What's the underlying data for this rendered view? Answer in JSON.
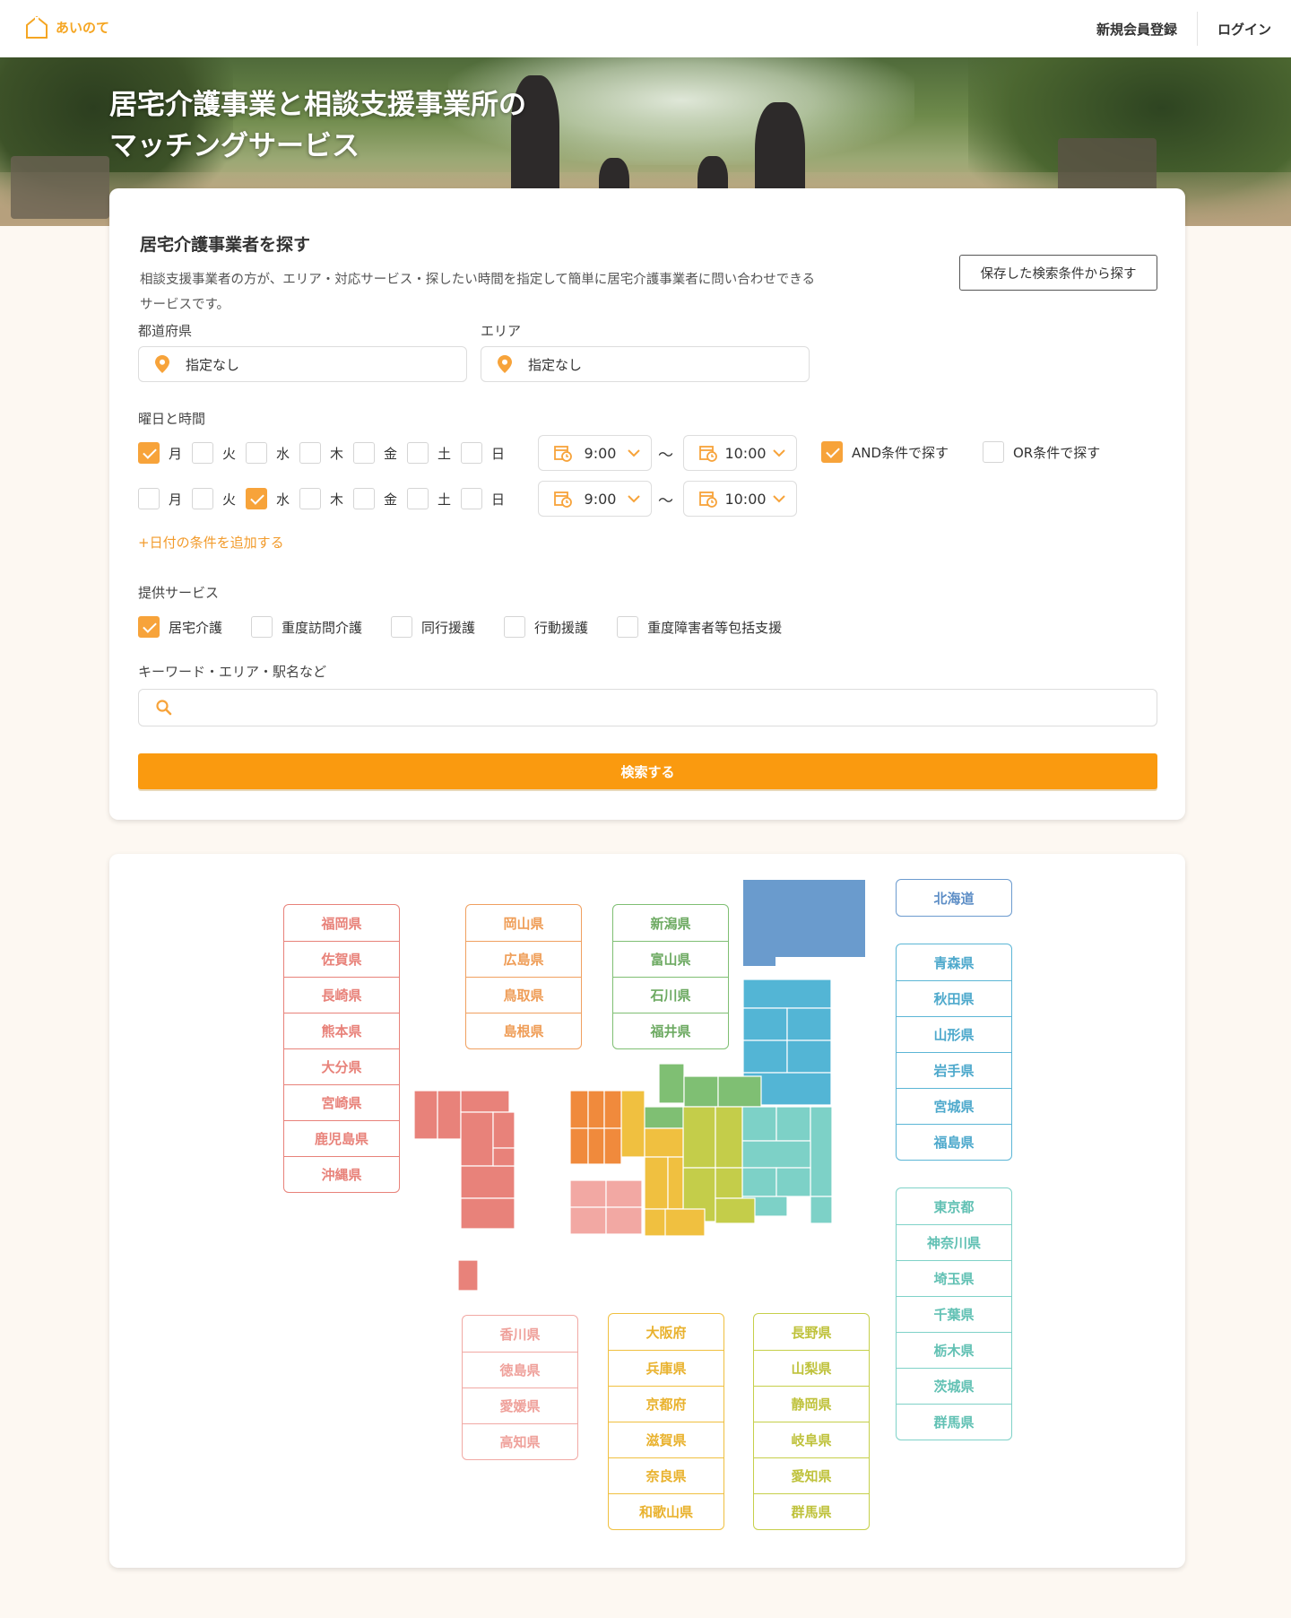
{
  "header": {
    "logo_text": "あいのて",
    "nav": {
      "register": "新規会員登録",
      "login": "ログイン"
    }
  },
  "hero": {
    "title_line1": "居宅介護事業と相談支援事業所の",
    "title_line2": "マッチングサービス"
  },
  "search": {
    "title": "居宅介護事業者を探す",
    "description": "相談支援事業者の方が、エリア・対応サービス・探したい時間を指定して簡単に居宅介護事業者に問い合わせできるサービスです。",
    "saved_button": "保存した検索条件から探す",
    "prefecture_label": "都道府県",
    "prefecture_value": "指定なし",
    "area_label": "エリア",
    "area_value": "指定なし",
    "schedule_label": "曜日と時間",
    "days": [
      "月",
      "火",
      "水",
      "木",
      "金",
      "土",
      "日"
    ],
    "rows": [
      {
        "checked": [
          true,
          false,
          false,
          false,
          false,
          false,
          false
        ],
        "start": "9:00",
        "end": "10:00"
      },
      {
        "checked": [
          false,
          false,
          true,
          false,
          false,
          false,
          false
        ],
        "start": "9:00",
        "end": "10:00"
      }
    ],
    "tilde": "〜",
    "and_label": "AND条件で探す",
    "or_label": "OR条件で探す",
    "add_date_link": "+日付の条件を追加する",
    "services_label": "提供サービス",
    "services": [
      {
        "label": "居宅介護",
        "checked": true
      },
      {
        "label": "重度訪問介護",
        "checked": false
      },
      {
        "label": "同行援護",
        "checked": false
      },
      {
        "label": "行動援護",
        "checked": false
      },
      {
        "label": "重度障害者等包括支援",
        "checked": false
      }
    ],
    "keyword_label": "キーワード・エリア・駅名など",
    "keyword_value": "",
    "submit": "検索する"
  },
  "map": {
    "kyushu": [
      "福岡県",
      "佐賀県",
      "長崎県",
      "熊本県",
      "大分県",
      "宮崎県",
      "鹿児島県",
      "沖縄県"
    ],
    "chugoku": [
      "岡山県",
      "広島県",
      "鳥取県",
      "島根県"
    ],
    "hokuriku": [
      "新潟県",
      "富山県",
      "石川県",
      "福井県"
    ],
    "hokkaido": [
      "北海道"
    ],
    "tohoku": [
      "青森県",
      "秋田県",
      "山形県",
      "岩手県",
      "宮城県",
      "福島県"
    ],
    "kanto": [
      "東京都",
      "神奈川県",
      "埼玉県",
      "千葉県",
      "栃木県",
      "茨城県",
      "群馬県"
    ],
    "shikoku": [
      "香川県",
      "徳島県",
      "愛媛県",
      "高知県"
    ],
    "kinki": [
      "大阪府",
      "兵庫県",
      "京都府",
      "滋賀県",
      "奈良県",
      "和歌山県"
    ],
    "chubu": [
      "長野県",
      "山梨県",
      "静岡県",
      "岐阜県",
      "愛知県",
      "群馬県"
    ],
    "colors": {
      "kyushu": "#e8827a",
      "chugoku": "#f0a060",
      "hokuriku": "#7fbf73",
      "hokkaido": "#6c9bcf",
      "tohoku": "#5cb6d6",
      "kanto": "#7fd2c8",
      "shikoku": "#f1a9a4",
      "kinki": "#f0c040",
      "chubu": "#c6cf4a"
    }
  },
  "accent_color": "#fa9a0f"
}
